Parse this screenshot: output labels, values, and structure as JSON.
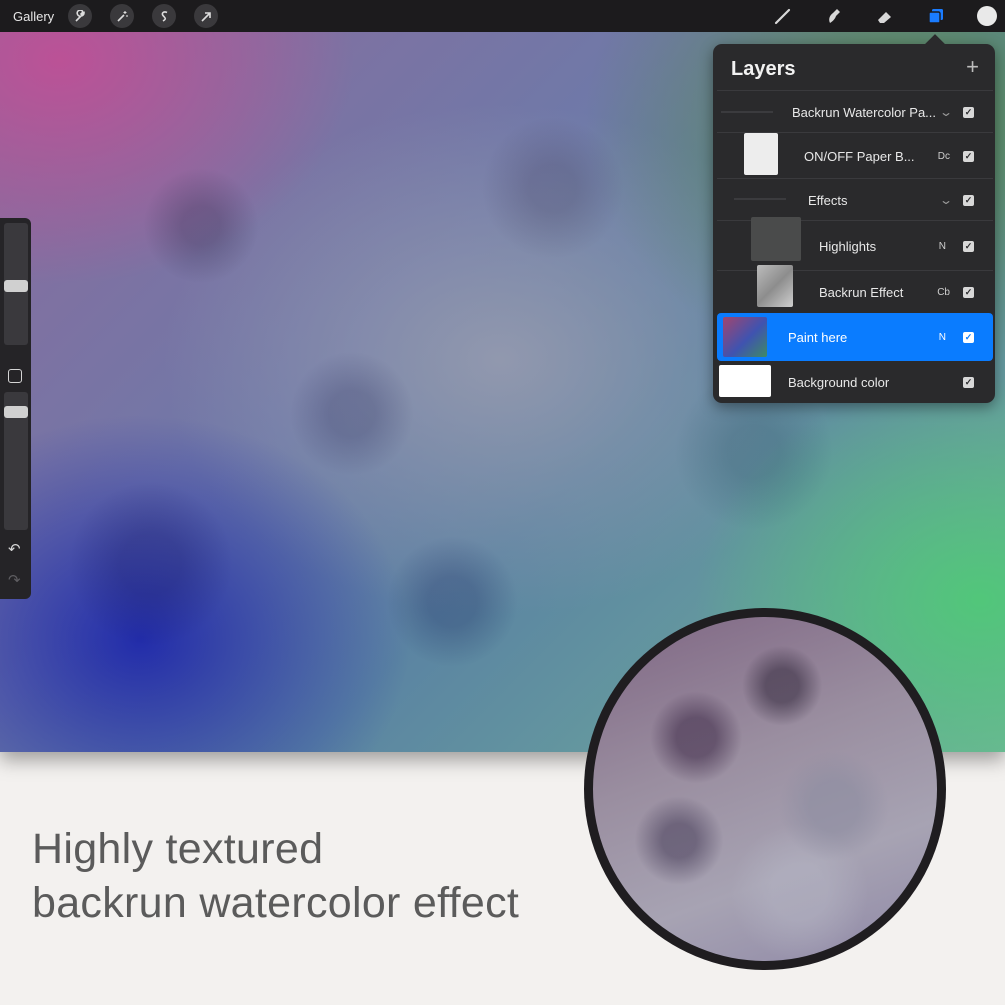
{
  "topbar": {
    "gallery_label": "Gallery",
    "left_tools": [
      "wrench-icon",
      "magic-wand-icon",
      "selection-icon",
      "transform-arrow-icon"
    ],
    "right_tools": [
      "brush-icon",
      "smudge-icon",
      "eraser-icon",
      "layers-icon",
      "color-swatch"
    ],
    "active_tool": "layers-icon",
    "accent_color": "#1a7cff",
    "current_color": "#e9e9e9"
  },
  "sidebar": {
    "brush_size_level": 0.26,
    "opacity_level": 0.1
  },
  "layers_panel": {
    "title": "Layers",
    "add_symbol": "+",
    "rows": [
      {
        "name": "Backrun Watercolor Pa...",
        "mode": "",
        "type": "group",
        "visible": true
      },
      {
        "name": "ON/OFF Paper B...",
        "mode": "Dc",
        "type": "layer",
        "visible": true
      },
      {
        "name": "Effects",
        "mode": "",
        "type": "group",
        "visible": true
      },
      {
        "name": "Highlights",
        "mode": "N",
        "type": "layer",
        "visible": true
      },
      {
        "name": "Backrun Effect",
        "mode": "Cb",
        "type": "layer",
        "visible": true
      },
      {
        "name": "Paint here",
        "mode": "N",
        "type": "layer",
        "visible": true,
        "selected": true
      },
      {
        "name": "Background color",
        "mode": "",
        "type": "background",
        "visible": true
      }
    ]
  },
  "caption": {
    "line1": "Highly textured",
    "line2": "backrun watercolor effect"
  }
}
